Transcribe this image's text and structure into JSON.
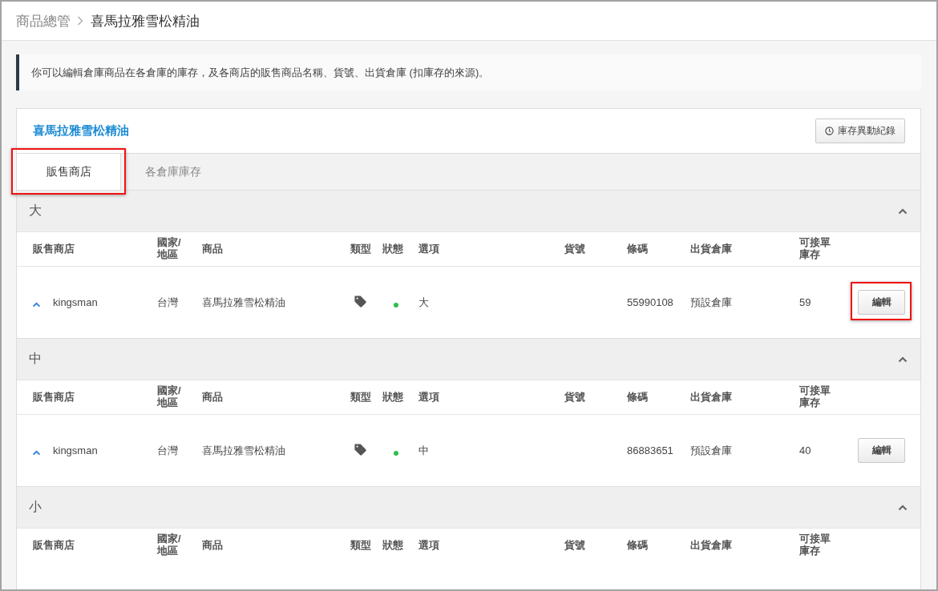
{
  "breadcrumb": {
    "parent": "商品總管",
    "current": "喜馬拉雅雪松精油"
  },
  "notice": "你可以編輯倉庫商品在各倉庫的庫存，及各商店的販售商品名稱、貨號、出貨倉庫 (扣庫存的來源)。",
  "card": {
    "title": "喜馬拉雅雪松精油",
    "history_button": "庫存異動紀錄",
    "tabs": [
      {
        "label": "販售商店",
        "selected": true,
        "highlighted": true
      },
      {
        "label": "各倉庫庫存",
        "selected": false,
        "highlighted": false
      }
    ],
    "sections": [
      {
        "title": "大",
        "expanded": true,
        "columns": [
          "販售商店",
          "國家/地區",
          "商品",
          "類型",
          "狀態",
          "選項",
          "貨號",
          "條碼",
          "出貨倉庫",
          "可接單庫存"
        ],
        "rows": [
          {
            "expanded": true,
            "shop": "kingsman",
            "country": "台灣",
            "product": "喜馬拉雅雪松精油",
            "status": {
              "color": "#2dbf4e"
            },
            "option": "大",
            "barcode": "55990108",
            "warehouse": "預設倉庫",
            "stock": "59",
            "action": {
              "label": "編輯",
              "highlighted": true
            }
          }
        ]
      },
      {
        "title": "中",
        "expanded": true,
        "columns": [
          "販售商店",
          "國家/地區",
          "商品",
          "類型",
          "狀態",
          "選項",
          "貨號",
          "條碼",
          "出貨倉庫",
          "可接單庫存"
        ],
        "rows": [
          {
            "expanded": true,
            "shop": "kingsman",
            "country": "台灣",
            "product": "喜馬拉雅雪松精油",
            "status": {
              "color": "#2dbf4e"
            },
            "option": "中",
            "barcode": "86883651",
            "warehouse": "預設倉庫",
            "stock": "40",
            "action": {
              "label": "編輯",
              "highlighted": false
            }
          }
        ]
      },
      {
        "title": "小",
        "expanded": true,
        "columns": [
          "販售商店",
          "國家/地區",
          "商品",
          "類型",
          "狀態",
          "選項",
          "貨號",
          "條碼",
          "出貨倉庫",
          "可接單庫存"
        ]
      }
    ]
  }
}
